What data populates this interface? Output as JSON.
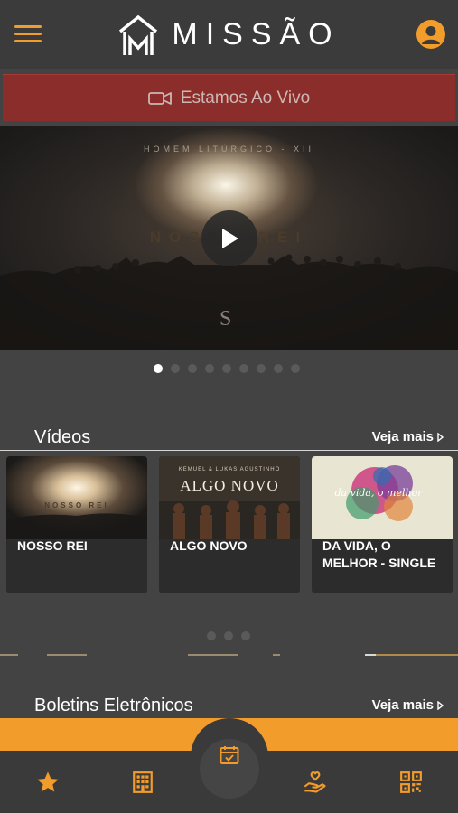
{
  "header": {
    "brand": "MISSÃO"
  },
  "live": {
    "label": "Estamos Ao Vivo"
  },
  "hero": {
    "kicker": "HOMEM LITÚRGICO - XII",
    "title": "NOSSO REI",
    "mark": "S",
    "slide_count": 9,
    "active_slide": 1
  },
  "videos": {
    "section_title": "Vídeos",
    "see_more": "Veja mais",
    "items": [
      {
        "label": "NOSSO REI",
        "thumb_title": "NOSSO REI"
      },
      {
        "label": "ALGO NOVO",
        "thumb_title": "ALGO NOVO",
        "thumb_kicker": "KEMUEL & LUKAS AGUSTINHO"
      },
      {
        "label": "DA VIDA, O MELHOR - SINGLE",
        "thumb_title": "da vida, o melhor"
      }
    ],
    "page_count": 3,
    "active_page": 1
  },
  "bulletins": {
    "section_title": "Boletins Eletrônicos",
    "see_more": "Veja mais"
  },
  "tabbar": {
    "items": [
      "star-icon",
      "building-icon",
      "calendar-check-icon",
      "donation-hand-icon",
      "qr-code-icon"
    ]
  },
  "colors": {
    "accent": "#f29c2b",
    "live_bar": "#8b2d2a",
    "background": "#434343"
  }
}
